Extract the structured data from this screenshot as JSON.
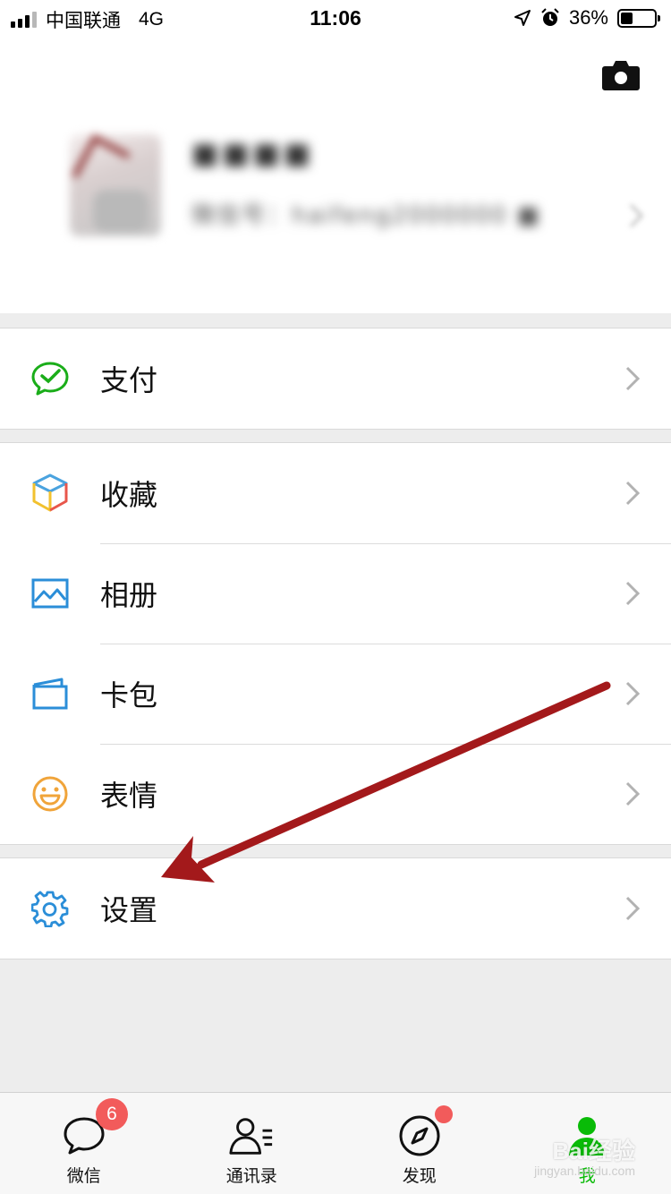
{
  "status_bar": {
    "carrier": "中国联通",
    "network": "4G",
    "time": "11:06",
    "battery_percent_text": "36%",
    "battery_level": 0.36,
    "location_icon": "location-arrow-icon",
    "alarm_icon": "alarm-icon"
  },
  "profile": {
    "camera_icon": "camera-icon",
    "nickname": "■■■■",
    "wechat_id": "微信号：haifeng2000000 ■",
    "chevron_icon": "chevron-right-icon"
  },
  "menu": {
    "group1": [
      {
        "label": "支付",
        "icon": "wechat-pay-icon",
        "color": "#1aad19"
      }
    ],
    "group2": [
      {
        "label": "收藏",
        "icon": "favorites-cube-icon"
      },
      {
        "label": "相册",
        "icon": "album-icon",
        "color": "#2b8ed8"
      },
      {
        "label": "卡包",
        "icon": "card-wallet-icon",
        "color": "#2b8ed8"
      },
      {
        "label": "表情",
        "icon": "sticker-smile-icon",
        "color": "#f0a43a"
      }
    ],
    "group3": [
      {
        "label": "设置",
        "icon": "settings-gear-icon",
        "color": "#2b8ed8"
      }
    ]
  },
  "annotation": {
    "color": "#a3191b",
    "target": "设置"
  },
  "tabbar": {
    "tabs": [
      {
        "label": "微信",
        "icon": "chat-bubble-icon",
        "badge": "6"
      },
      {
        "label": "通讯录",
        "icon": "contacts-icon"
      },
      {
        "label": "发现",
        "icon": "discover-compass-icon",
        "dot": true
      },
      {
        "label": "我",
        "icon": "me-person-icon",
        "active": true
      }
    ],
    "active_color": "#09bb07",
    "badge_color": "#f25b5b"
  },
  "watermark": {
    "text": "Bai经验",
    "sub": "jingyan.baidu.com"
  }
}
